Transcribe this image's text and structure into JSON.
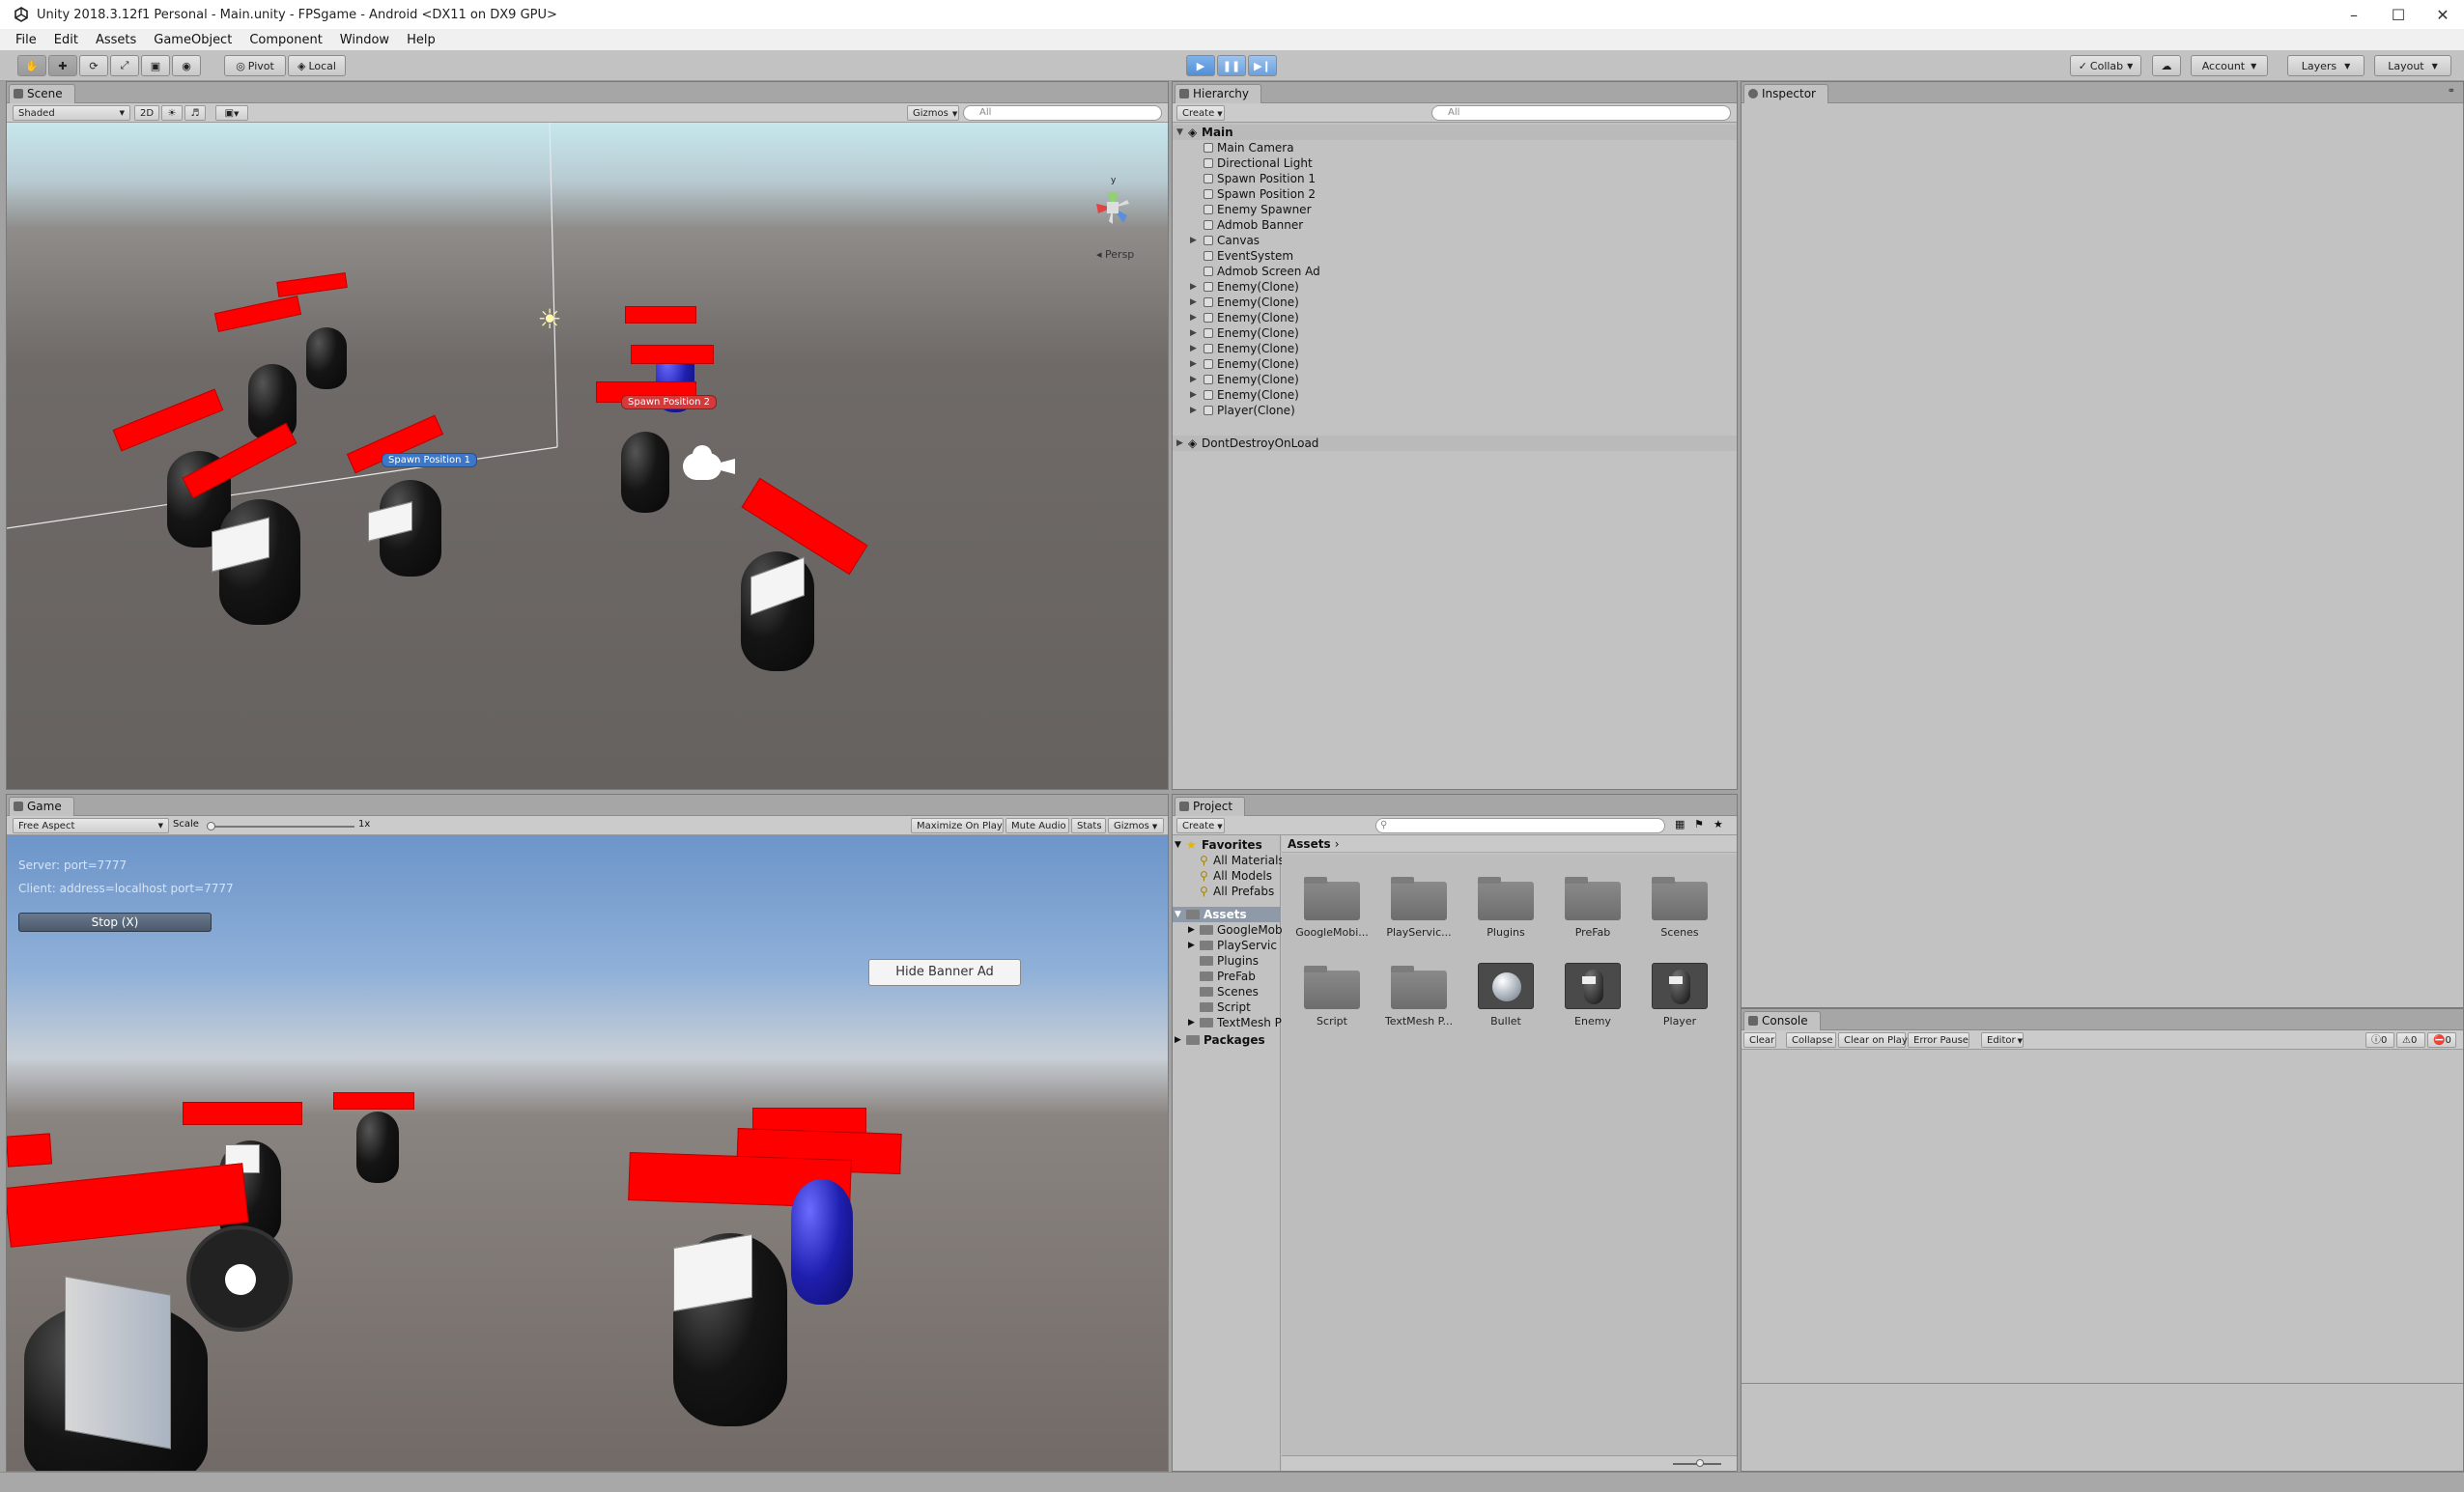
{
  "window": {
    "title": "Unity 2018.3.12f1 Personal - Main.unity - FPSgame - Android <DX11 on DX9 GPU>"
  },
  "menu": [
    "File",
    "Edit",
    "Assets",
    "GameObject",
    "Component",
    "Window",
    "Help"
  ],
  "toolbar": {
    "pivot_label": "Pivot",
    "local_label": "Local",
    "collab_label": "Collab",
    "account_label": "Account",
    "layers_label": "Layers",
    "layout_label": "Layout"
  },
  "scene": {
    "tab_label": "Scene",
    "shading_mode": "Shaded",
    "mode_2d": "2D",
    "gizmos_label": "Gizmos",
    "search_placeholder": "All",
    "persp_label": "Persp",
    "spawn1_label": "Spawn Position 1",
    "spawn2_label": "Spawn Position 2"
  },
  "game": {
    "tab_label": "Game",
    "aspect": "Free Aspect",
    "scale_label": "Scale",
    "scale_value": "1x",
    "maximize_label": "Maximize On Play",
    "mute_label": "Mute Audio",
    "stats_label": "Stats",
    "gizmos_label": "Gizmos",
    "server_text": "Server: port=7777",
    "client_text": "Client: address=localhost port=7777",
    "stop_button": "Stop (X)",
    "hide_banner_button": "Hide Banner Ad"
  },
  "hierarchy": {
    "tab_label": "Hierarchy",
    "create_label": "Create",
    "search_placeholder": "All",
    "scene_name": "Main",
    "items": [
      {
        "label": "Main Camera",
        "expandable": false
      },
      {
        "label": "Directional Light",
        "expandable": false
      },
      {
        "label": "Spawn Position 1",
        "expandable": false
      },
      {
        "label": "Spawn Position 2",
        "expandable": false
      },
      {
        "label": "Enemy Spawner",
        "expandable": false
      },
      {
        "label": "Admob Banner",
        "expandable": false
      },
      {
        "label": "Canvas",
        "expandable": true
      },
      {
        "label": "EventSystem",
        "expandable": false
      },
      {
        "label": "Admob Screen Ad",
        "expandable": false
      },
      {
        "label": "Enemy(Clone)",
        "expandable": true
      },
      {
        "label": "Enemy(Clone)",
        "expandable": true
      },
      {
        "label": "Enemy(Clone)",
        "expandable": true
      },
      {
        "label": "Enemy(Clone)",
        "expandable": true
      },
      {
        "label": "Enemy(Clone)",
        "expandable": true
      },
      {
        "label": "Enemy(Clone)",
        "expandable": true
      },
      {
        "label": "Enemy(Clone)",
        "expandable": true
      },
      {
        "label": "Enemy(Clone)",
        "expandable": true
      },
      {
        "label": "Player(Clone)",
        "expandable": true
      }
    ],
    "dont_destroy": "DontDestroyOnLoad"
  },
  "inspector": {
    "tab_label": "Inspector"
  },
  "project": {
    "tab_label": "Project",
    "create_label": "Create",
    "favorites_label": "Favorites",
    "favorites": [
      "All Materials",
      "All Models",
      "All Prefabs"
    ],
    "assets_label": "Assets",
    "asset_folders": [
      "GoogleMobi",
      "PlayServic",
      "Plugins",
      "PreFab",
      "Scenes",
      "Script",
      "TextMesh P"
    ],
    "packages_label": "Packages",
    "breadcrumb": "Assets",
    "grid_items": [
      {
        "label": "GoogleMobi...",
        "kind": "folder"
      },
      {
        "label": "PlayServic...",
        "kind": "folder"
      },
      {
        "label": "Plugins",
        "kind": "folder"
      },
      {
        "label": "PreFab",
        "kind": "folder"
      },
      {
        "label": "Scenes",
        "kind": "folder"
      },
      {
        "label": "Script",
        "kind": "folder"
      },
      {
        "label": "TextMesh P...",
        "kind": "folder"
      },
      {
        "label": "Bullet",
        "kind": "sphere"
      },
      {
        "label": "Enemy",
        "kind": "prefab"
      },
      {
        "label": "Player",
        "kind": "prefab"
      }
    ]
  },
  "console": {
    "tab_label": "Console",
    "clear_label": "Clear",
    "collapse_label": "Collapse",
    "clear_on_play_label": "Clear on Play",
    "error_pause_label": "Error Pause",
    "editor_label": "Editor",
    "info_count": "0",
    "warn_count": "0",
    "error_count": "0"
  }
}
